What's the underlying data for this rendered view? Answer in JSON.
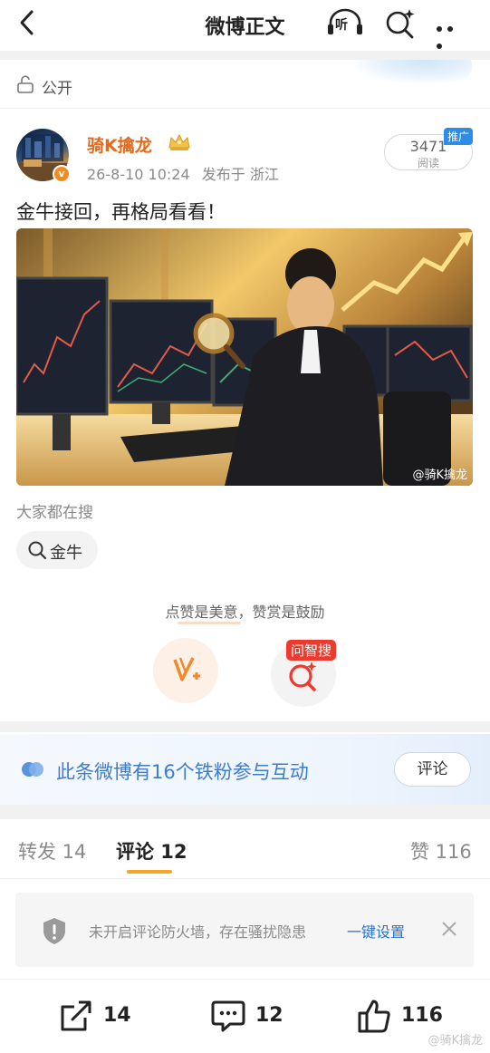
{
  "header": {
    "title": "微博正文",
    "listen_label": "听"
  },
  "post": {
    "visibility": "公开",
    "author": {
      "name": "骑K擒龙",
      "verified_badge": "v"
    },
    "time": "26-8-10 10:24",
    "location": "发布于 浙江",
    "reads": {
      "count": "3471",
      "label": "阅读"
    },
    "promo_tag": "推广",
    "text": "金牛接回，再格局看看！",
    "image_watermark": "@骑K擒龙"
  },
  "trending": {
    "label": "大家都在搜",
    "chip": "金牛"
  },
  "engage": {
    "tip_left": "点赞是美意，",
    "tip_right": "赞赏是鼓励",
    "zhisou_tag": "问智搜"
  },
  "fans_bar": {
    "text": "此条微博有16个铁粉参与互动",
    "button": "评论"
  },
  "tabs": {
    "repost": "转发 14",
    "comments": "评论 12",
    "likes": "赞 116"
  },
  "firewall": {
    "text": "未开启评论防火墙，存在骚扰隐患",
    "link": "一键设置"
  },
  "actions": {
    "repost_count": "14",
    "comment_count": "12",
    "like_count": "116"
  },
  "bottom_watermark": "@骑K擒龙",
  "colors": {
    "accent_orange": "#e46a1b",
    "link_blue": "#2e73c6",
    "tab_underline": "#f6a623"
  }
}
